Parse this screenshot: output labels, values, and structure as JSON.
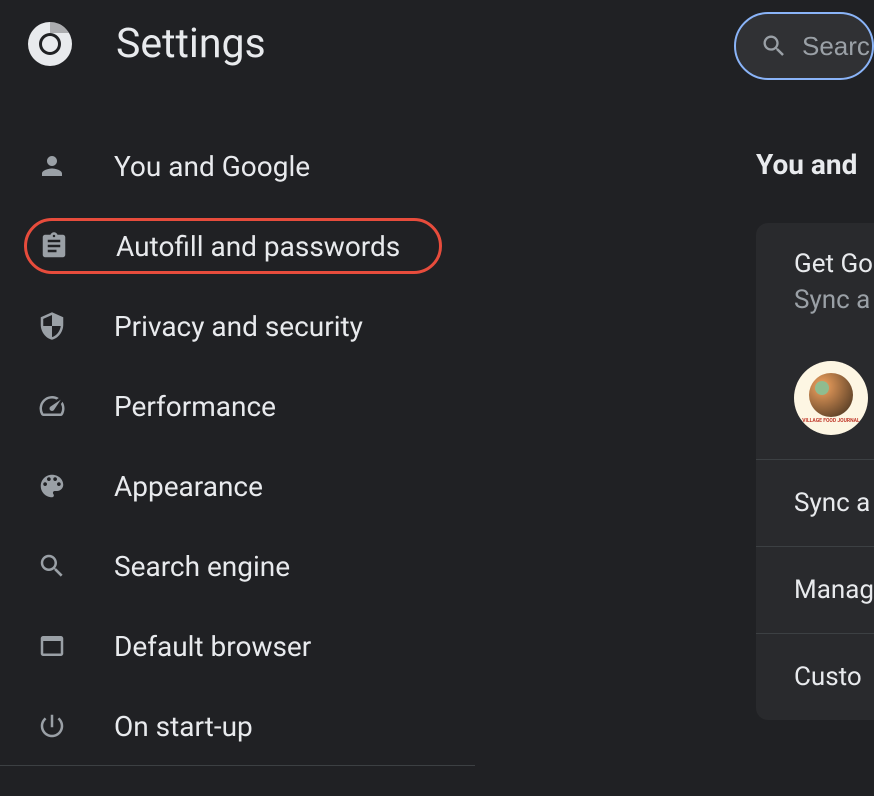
{
  "header": {
    "title": "Settings"
  },
  "search": {
    "placeholder": "Searc"
  },
  "sidebar": {
    "items": [
      {
        "label": "You and Google",
        "icon": "person"
      },
      {
        "label": "Autofill and passwords",
        "icon": "clipboard",
        "highlighted": true
      },
      {
        "label": "Privacy and security",
        "icon": "shield"
      },
      {
        "label": "Performance",
        "icon": "speedometer"
      },
      {
        "label": "Appearance",
        "icon": "palette"
      },
      {
        "label": "Search engine",
        "icon": "search"
      },
      {
        "label": "Default browser",
        "icon": "browser"
      },
      {
        "label": "On start-up",
        "icon": "power"
      }
    ]
  },
  "rightPanel": {
    "sectionTitle": "You and ",
    "card": {
      "title": "Get Go",
      "subtitle": "Sync a",
      "avatarText": "VILLAGE FOOD JOURNAL",
      "rows": [
        {
          "label": "Sync a"
        },
        {
          "label": "Manag"
        },
        {
          "label": "Custo"
        }
      ]
    }
  }
}
